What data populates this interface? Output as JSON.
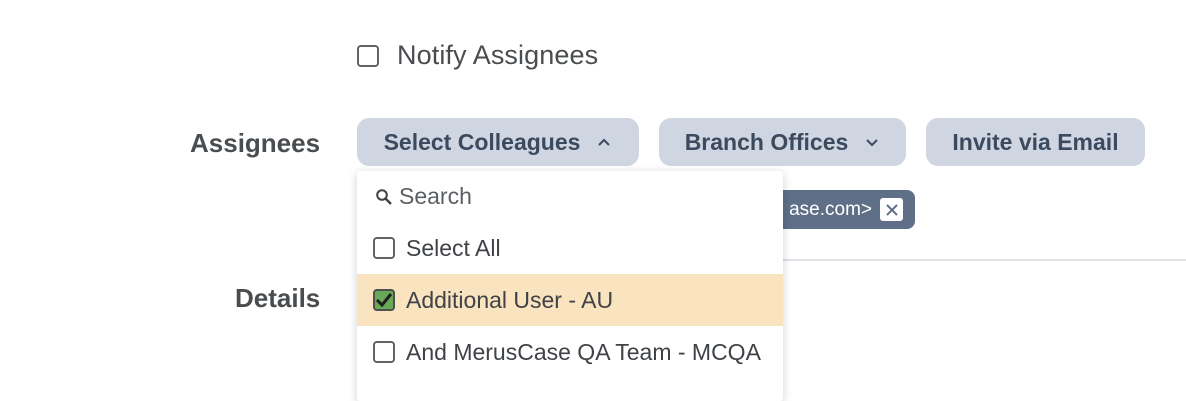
{
  "notify": {
    "label": "Notify Assignees",
    "checked": false
  },
  "labels": {
    "assignees": "Assignees",
    "details": "Details"
  },
  "buttons": {
    "select_colleagues": "Select Colleagues",
    "branch_offices": "Branch Offices",
    "invite_email": "Invite via Email"
  },
  "tag": {
    "text": "ase.com>"
  },
  "dropdown": {
    "search_placeholder": "Search",
    "items": [
      {
        "label": "Select All",
        "checked": false
      },
      {
        "label": "Additional User - AU",
        "checked": true
      },
      {
        "label": "And MerusCase QA Team - MCQA",
        "checked": false
      }
    ]
  },
  "colors": {
    "pill_bg": "#cfd5e1",
    "pill_text": "#3b4a5e",
    "tag_bg": "#5f6f88",
    "selected_row": "#fae3bf",
    "checkbox_checked": "#67a957"
  }
}
